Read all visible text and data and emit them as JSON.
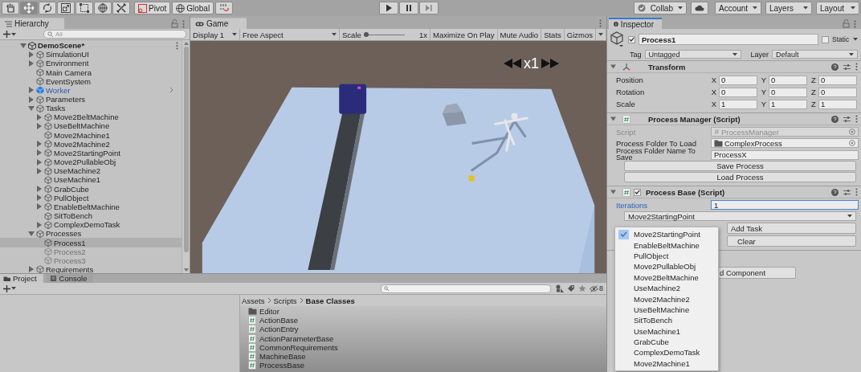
{
  "toolbar": {
    "tools": [
      {
        "kind": "hand",
        "selected": false
      },
      {
        "kind": "move",
        "selected": true
      },
      {
        "kind": "rotate",
        "selected": false
      },
      {
        "kind": "scale",
        "selected": false
      },
      {
        "kind": "rect",
        "selected": false
      },
      {
        "kind": "transform",
        "selected": false
      },
      {
        "kind": "custom",
        "selected": false
      }
    ],
    "pivot": "Pivot",
    "global": "Global",
    "playback": [
      {
        "kind": "play"
      },
      {
        "kind": "pause"
      },
      {
        "kind": "step"
      }
    ],
    "collab": "Collab",
    "account": "Account",
    "layers": "Layers",
    "layout": "Layout"
  },
  "hierarchy": {
    "tab": "Hierarchy",
    "search": {
      "placeholder": "All"
    },
    "items": [
      {
        "label": "DemoScene*",
        "kind": "scene",
        "expandable": true,
        "expanded": true,
        "selected": false,
        "disabled": false,
        "children": [
          {
            "label": "SimulationUI",
            "kind": "object",
            "expandable": true,
            "expanded": false,
            "selected": false,
            "disabled": false
          },
          {
            "label": "Environment",
            "kind": "object",
            "expandable": true,
            "expanded": false,
            "selected": false,
            "disabled": false
          },
          {
            "label": "Main Camera",
            "kind": "object",
            "expandable": false,
            "selected": false,
            "disabled": false
          },
          {
            "label": "EventSystem",
            "kind": "object",
            "expandable": false,
            "selected": false,
            "disabled": false
          },
          {
            "label": "Worker",
            "kind": "prefab",
            "expandable": true,
            "expanded": false,
            "selected": false,
            "disabled": false
          },
          {
            "label": "Parameters",
            "kind": "object",
            "expandable": true,
            "expanded": false,
            "selected": false,
            "disabled": false
          },
          {
            "label": "Tasks",
            "kind": "object",
            "expandable": true,
            "expanded": true,
            "selected": false,
            "disabled": false,
            "children": [
              {
                "label": "Move2BeltMachine",
                "kind": "object",
                "expandable": true,
                "expanded": false,
                "selected": false,
                "disabled": false
              },
              {
                "label": "UseBeltMachine",
                "kind": "object",
                "expandable": true,
                "expanded": false,
                "selected": false,
                "disabled": false
              },
              {
                "label": "Move2Machine1",
                "kind": "object",
                "expandable": false,
                "selected": false,
                "disabled": false
              },
              {
                "label": "Move2Machine2",
                "kind": "object",
                "expandable": true,
                "expanded": false,
                "selected": false,
                "disabled": false
              },
              {
                "label": "Move2StartingPoint",
                "kind": "object",
                "expandable": true,
                "expanded": false,
                "selected": false,
                "disabled": false
              },
              {
                "label": "Move2PullableObj",
                "kind": "object",
                "expandable": true,
                "expanded": false,
                "selected": false,
                "disabled": false
              },
              {
                "label": "UseMachine2",
                "kind": "object",
                "expandable": true,
                "expanded": false,
                "selected": false,
                "disabled": false
              },
              {
                "label": "UseMachine1",
                "kind": "object",
                "expandable": false,
                "selected": false,
                "disabled": false
              },
              {
                "label": "GrabCube",
                "kind": "object",
                "expandable": true,
                "expanded": false,
                "selected": false,
                "disabled": false
              },
              {
                "label": "PullObject",
                "kind": "object",
                "expandable": true,
                "expanded": false,
                "selected": false,
                "disabled": false
              },
              {
                "label": "EnableBeltMachine",
                "kind": "object",
                "expandable": true,
                "expanded": false,
                "selected": false,
                "disabled": false
              },
              {
                "label": "SitToBench",
                "kind": "object",
                "expandable": false,
                "selected": false,
                "disabled": false
              },
              {
                "label": "ComplexDemoTask",
                "kind": "object",
                "expandable": true,
                "expanded": false,
                "selected": false,
                "disabled": false
              }
            ]
          },
          {
            "label": "Processes",
            "kind": "object",
            "expandable": true,
            "expanded": true,
            "selected": false,
            "disabled": false,
            "children": [
              {
                "label": "Process1",
                "kind": "object",
                "expandable": false,
                "selected": true,
                "disabled": false
              },
              {
                "label": "Process2",
                "kind": "object",
                "expandable": false,
                "selected": false,
                "disabled": true
              },
              {
                "label": "Process3",
                "kind": "object",
                "expandable": false,
                "selected": false,
                "disabled": true
              }
            ]
          },
          {
            "label": "Requirements",
            "kind": "object",
            "expandable": true,
            "expanded": false,
            "selected": false,
            "disabled": false
          }
        ]
      }
    ]
  },
  "game": {
    "tab": "Game",
    "display": "Display 1",
    "aspect": "Free Aspect",
    "scale_label": "Scale",
    "scale": {
      "level": 0.04
    },
    "scale_value": "1x",
    "buttons": [
      "Maximize On Play",
      "Mute Audio",
      "Stats",
      "Gizmos"
    ],
    "speed": "x1"
  },
  "inspector": {
    "tab": "Inspector",
    "object": {
      "active": true,
      "name": "Process1",
      "static": false,
      "static_label": "Static",
      "tag_label": "Tag",
      "tag": "Untagged",
      "layer_label": "Layer",
      "layer": "Default"
    },
    "components": [
      {
        "kind": "transform",
        "title": "Transform",
        "expanded": true,
        "rows": [
          {
            "label": "Position",
            "values": [
              {
                "axis": "X",
                "value": "0"
              },
              {
                "axis": "Y",
                "value": "0"
              },
              {
                "axis": "Z",
                "value": "0"
              }
            ]
          },
          {
            "label": "Rotation",
            "values": [
              {
                "axis": "X",
                "value": "0"
              },
              {
                "axis": "Y",
                "value": "0"
              },
              {
                "axis": "Z",
                "value": "0"
              }
            ]
          },
          {
            "label": "Scale",
            "values": [
              {
                "axis": "X",
                "value": "1"
              },
              {
                "axis": "Y",
                "value": "1"
              },
              {
                "axis": "Z",
                "value": "1"
              }
            ]
          }
        ]
      },
      {
        "kind": "script",
        "title": "Process Manager (Script)",
        "expanded": true,
        "fields": [
          {
            "kind": "object",
            "label": "Script",
            "value": "ProcessManager",
            "disabled": true
          },
          {
            "kind": "folder",
            "label": "Process Folder To Load",
            "value": "ComplexProcess",
            "disabled": false
          },
          {
            "kind": "text",
            "label": "Process Folder Name To Save",
            "value": "ProcessX",
            "disabled": false
          },
          {
            "kind": "button",
            "label": "Save Process"
          },
          {
            "kind": "button",
            "label": "Load Process"
          }
        ]
      },
      {
        "kind": "script",
        "title": "Process Base (Script)",
        "expanded": true,
        "enabled": true,
        "fields": [
          {
            "kind": "number",
            "label": "Iterations",
            "value": "1",
            "focused": true
          },
          {
            "kind": "popup",
            "value": "Move2StartingPoint"
          },
          {
            "kind": "side_button",
            "label": "Add Task"
          },
          {
            "kind": "side_button",
            "label": "Clear"
          }
        ]
      }
    ],
    "add_component": "d Component",
    "popup_menu": {
      "options": [
        {
          "label": "Move2StartingPoint",
          "selected": true
        },
        {
          "label": "EnableBeltMachine",
          "selected": false
        },
        {
          "label": "PullObject",
          "selected": false
        },
        {
          "label": "Move2PullableObj",
          "selected": false
        },
        {
          "label": "Move2BeltMachine",
          "selected": false
        },
        {
          "label": "UseMachine2",
          "selected": false
        },
        {
          "label": "Move2Machine2",
          "selected": false
        },
        {
          "label": "UseBeltMachine",
          "selected": false
        },
        {
          "label": "SitToBench",
          "selected": false
        },
        {
          "label": "UseMachine1",
          "selected": false
        },
        {
          "label": "GrabCube",
          "selected": false
        },
        {
          "label": "ComplexDemoTask",
          "selected": false
        },
        {
          "label": "Move2Machine1",
          "selected": false
        }
      ]
    }
  },
  "project": {
    "tabs": [
      {
        "label": "Project",
        "selected": true
      },
      {
        "label": "Console",
        "selected": false
      }
    ],
    "hidden_count": "8",
    "breadcrumb": [
      "Assets",
      "Scripts",
      "Base Classes"
    ],
    "files": [
      {
        "kind": "folder",
        "name": "Editor"
      },
      {
        "kind": "script",
        "name": "ActionBase"
      },
      {
        "kind": "script",
        "name": "ActionEntry"
      },
      {
        "kind": "script",
        "name": "ActionParameterBase"
      },
      {
        "kind": "script",
        "name": "CommonRequirements"
      },
      {
        "kind": "script",
        "name": "MachineBase"
      },
      {
        "kind": "script",
        "name": "ProcessBase"
      }
    ]
  }
}
